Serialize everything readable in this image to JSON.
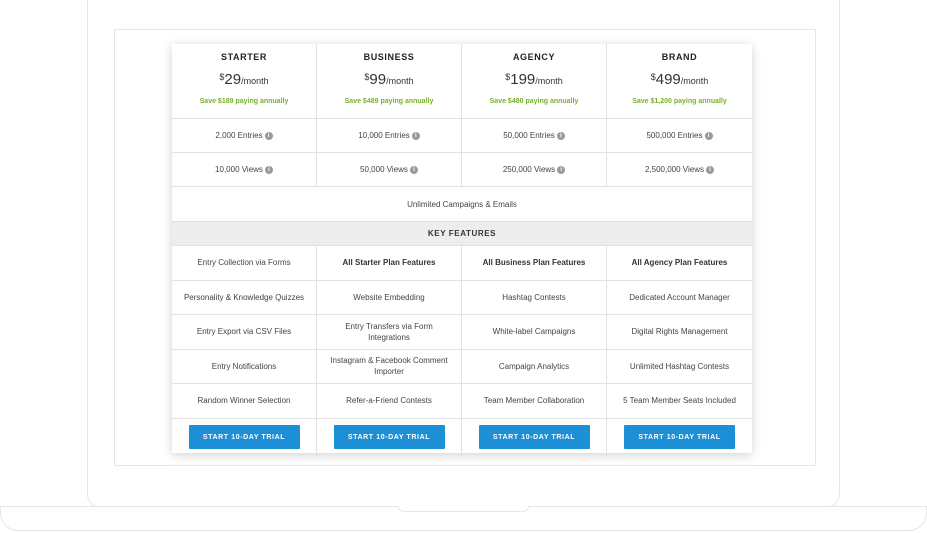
{
  "plans": [
    {
      "name": "STARTER",
      "currency": "$",
      "price": "29",
      "period": "/month",
      "save": "Save $189 paying annually"
    },
    {
      "name": "BUSINESS",
      "currency": "$",
      "price": "99",
      "period": "/month",
      "save": "Save $489 paying annually"
    },
    {
      "name": "AGENCY",
      "currency": "$",
      "price": "199",
      "period": "/month",
      "save": "Save $480 paying annually"
    },
    {
      "name": "BRAND",
      "currency": "$",
      "price": "499",
      "period": "/month",
      "save": "Save $1,200 paying annually"
    }
  ],
  "entries": [
    "2,000 Entries",
    "10,000 Entries",
    "50,000 Entries",
    "500,000 Entries"
  ],
  "views": [
    "10,000 Views",
    "50,000 Views",
    "250,000 Views",
    "2,500,000 Views"
  ],
  "info_icon": {
    "glyph": "i",
    "name": "info-icon"
  },
  "unlimited": "Unlimited Campaigns & Emails",
  "key_features_title": "KEY FEATURES",
  "features": [
    [
      "Entry Collection via Forms",
      "All Starter Plan Features",
      "All Business Plan Features",
      "All Agency Plan Features"
    ],
    [
      "Personality & Knowledge Quizzes",
      "Website Embedding",
      "Hashtag Contests",
      "Dedicated Account Manager"
    ],
    [
      "Entry Export via CSV Files",
      "Entry Transfers via Form Integrations",
      "White-label Campaigns",
      "Digital Rights Management"
    ],
    [
      "Entry Notifications",
      "Instagram & Facebook Comment Importer",
      "Campaign Analytics",
      "Unlimited Hashtag Contests"
    ],
    [
      "Random Winner Selection",
      "Refer-a-Friend Contests",
      "Team Member Collaboration",
      "5 Team Member Seats Included"
    ]
  ],
  "cta_label": "START 10-DAY TRIAL",
  "colors": {
    "accent": "#1d8fd6",
    "savings": "#7ab02c",
    "section_bg": "#ededed"
  }
}
